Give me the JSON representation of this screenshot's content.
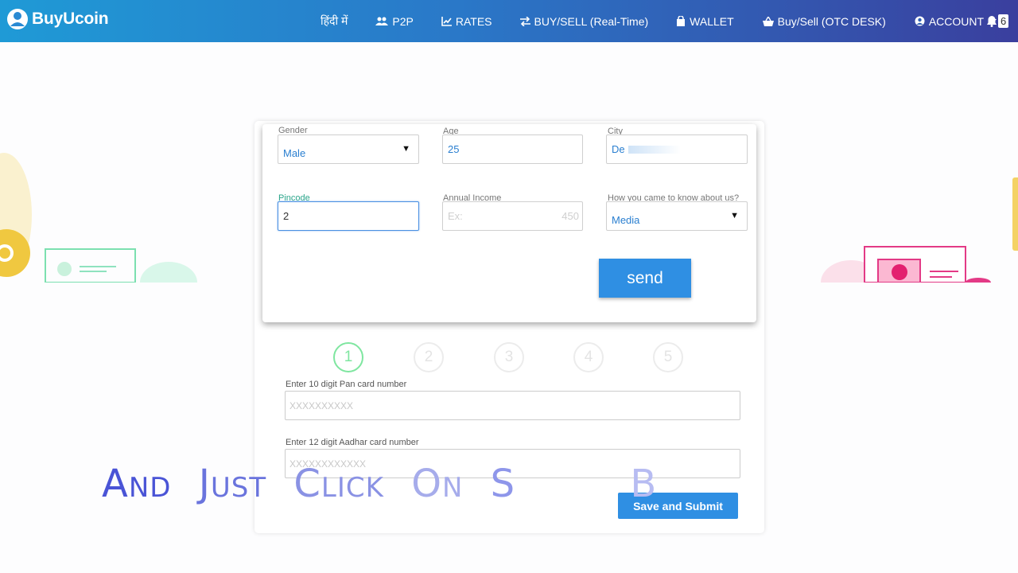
{
  "navbar": {
    "brand": "BuyUcoin",
    "items": [
      {
        "label": "हिंदी में",
        "icon": "none"
      },
      {
        "label": "P2P",
        "icon": "users-icon"
      },
      {
        "label": "RATES",
        "icon": "chart-icon"
      },
      {
        "label": "BUY/SELL (Real-Time)",
        "icon": "exchange-icon"
      },
      {
        "label": "WALLET",
        "icon": "bag-icon"
      },
      {
        "label": "Buy/Sell (OTC DESK)",
        "icon": "basket-icon"
      },
      {
        "label": "ACCOUNT",
        "icon": "user-circle-icon"
      }
    ],
    "notification_count": "6",
    "colors": {
      "gradient_start": "#1f9ad6",
      "gradient_end": "#3a3f9e"
    }
  },
  "popup": {
    "gender": {
      "label": "Gender",
      "value": "Male"
    },
    "age": {
      "label": "Age",
      "value": "25"
    },
    "city": {
      "label": "City",
      "value": "De"
    },
    "pincode": {
      "label": "Pincode",
      "value": "2"
    },
    "income": {
      "label": "Annual Income",
      "placeholder": "Ex:",
      "hint": "450"
    },
    "source": {
      "label": "How you came to know about us?",
      "value": "Media"
    },
    "send_label": "send"
  },
  "steps": [
    "1",
    "2",
    "3",
    "4",
    "5"
  ],
  "active_step": "1",
  "pan": {
    "label": "Enter 10 digit Pan card number",
    "placeholder": "XXXXXXXXXX"
  },
  "aadhar": {
    "label": "Enter 12 digit Aadhar card number",
    "placeholder": "XXXXXXXXXXXX"
  },
  "save_label": "Save and Submit",
  "caption": {
    "words": [
      "And",
      "Just",
      "Click",
      "On",
      "S",
      "B"
    ]
  },
  "accent_color": "#2f8fe3"
}
